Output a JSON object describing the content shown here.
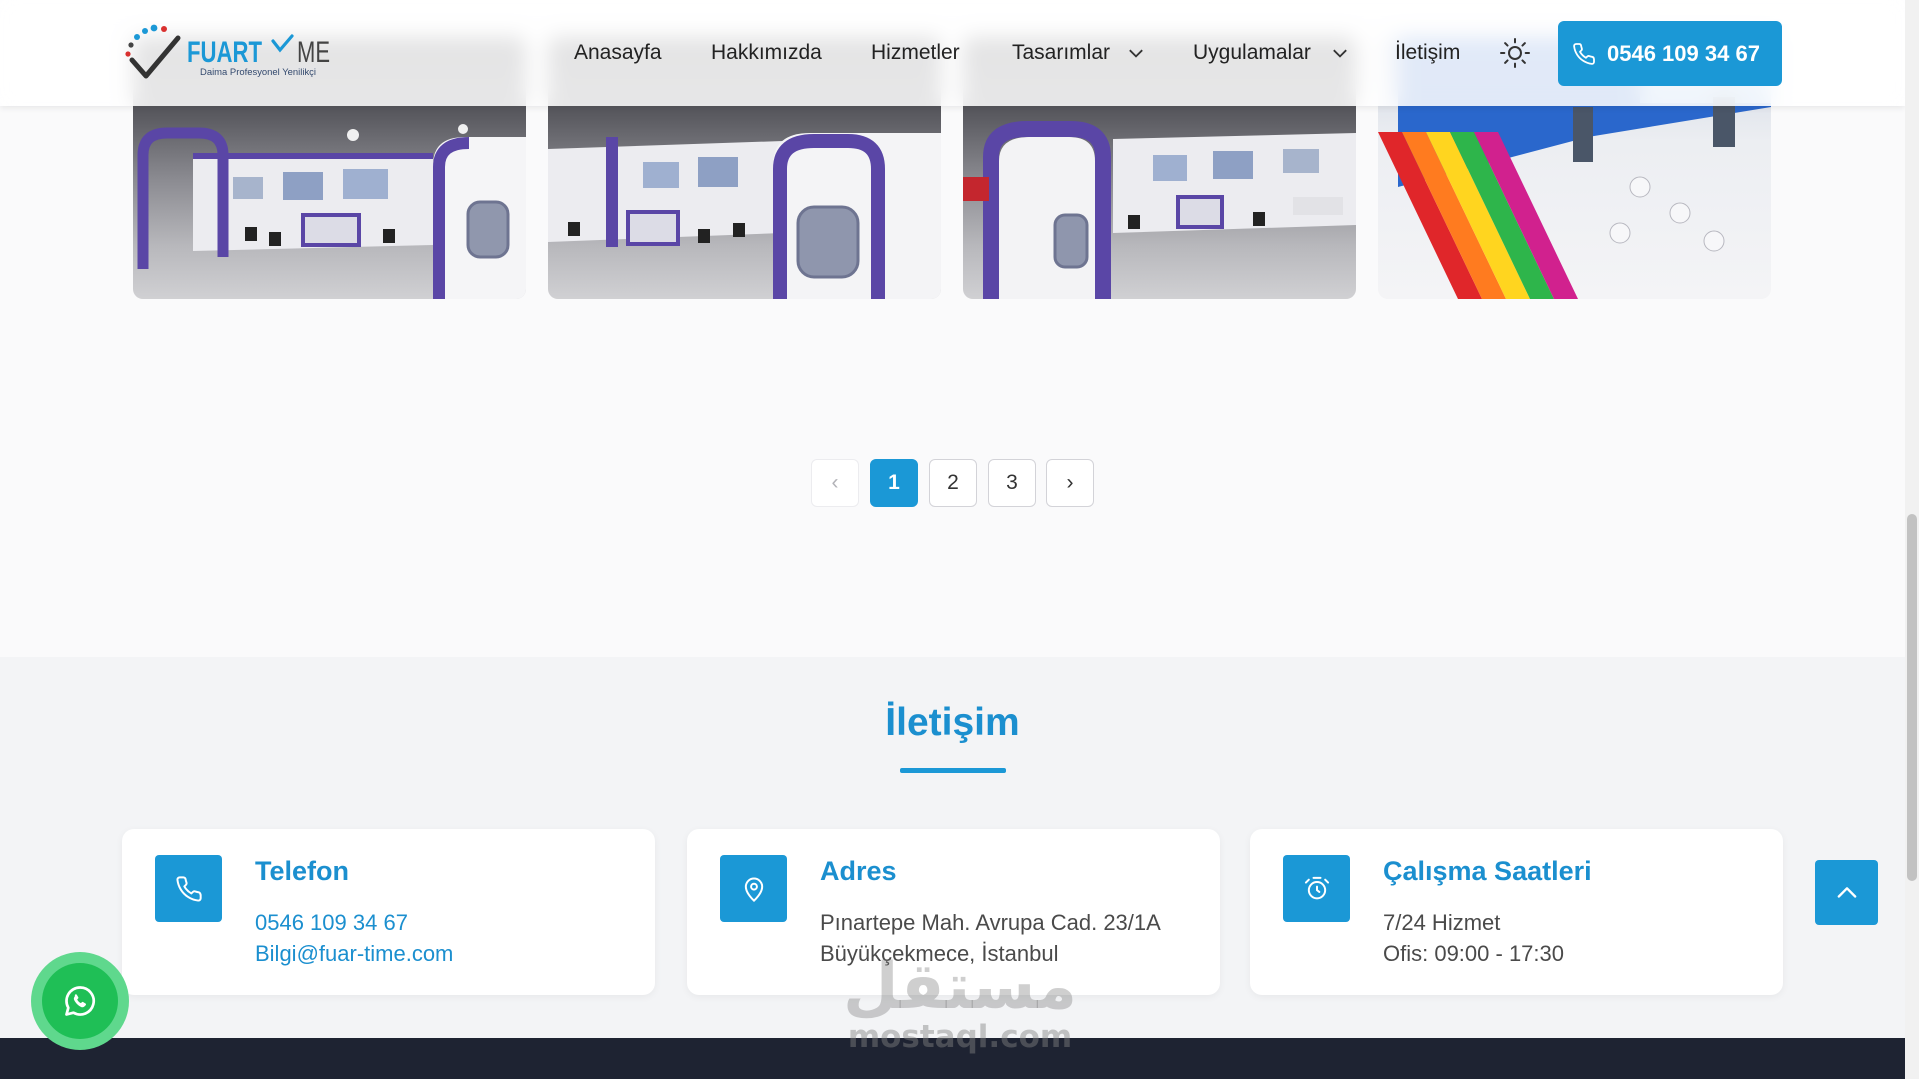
{
  "colors": {
    "primary": "#1b98d6",
    "heading": "#1b8fcf",
    "whatsapp": "#1fbf56",
    "footer": "#1e2332",
    "page_bg": "#fafafb",
    "section_bg": "#f3f4f6"
  },
  "header": {
    "logo": {
      "text_a": "FUART",
      "text_b": "ME",
      "tagline": "Daima Profesyonel Yenilikçi"
    },
    "nav": [
      {
        "label": "Anasayfa"
      },
      {
        "label": "Hakkımızda"
      },
      {
        "label": "Hizmetler"
      },
      {
        "label": "Tasarımlar",
        "dropdown": true
      },
      {
        "label": "Uygulamalar",
        "dropdown": true
      },
      {
        "label": "İletişim"
      }
    ],
    "theme_toggle_icon": "sun-icon",
    "phone_button": {
      "icon": "phone-icon",
      "label": "0546 109 34 67"
    }
  },
  "pagination": {
    "prev": "‹",
    "pages": [
      "1",
      "2",
      "3"
    ],
    "current": "1",
    "next": "›"
  },
  "contact": {
    "title": "İletişim",
    "cards": [
      {
        "icon": "phone-icon",
        "title": "Telefon",
        "lines": [
          "0546 109 34 67",
          "Bilgi@fuar-time.com"
        ]
      },
      {
        "icon": "map-pin-icon",
        "title": "Adres",
        "lines": [
          "Pınartepe Mah. Avrupa Cad. 23/1A",
          "Büyükçekmece, İstanbul"
        ]
      },
      {
        "icon": "alarm-clock-icon",
        "title": "Çalışma Saatleri",
        "lines": [
          "7/24 Hizmet",
          "Ofis: 09:00 - 17:30"
        ]
      }
    ]
  },
  "floating": {
    "whatsapp_icon": "whatsapp-icon",
    "scroll_top_icon": "chevron-up-icon"
  },
  "watermark": {
    "arabic": "مستقل",
    "latin": "mostaql.com"
  }
}
